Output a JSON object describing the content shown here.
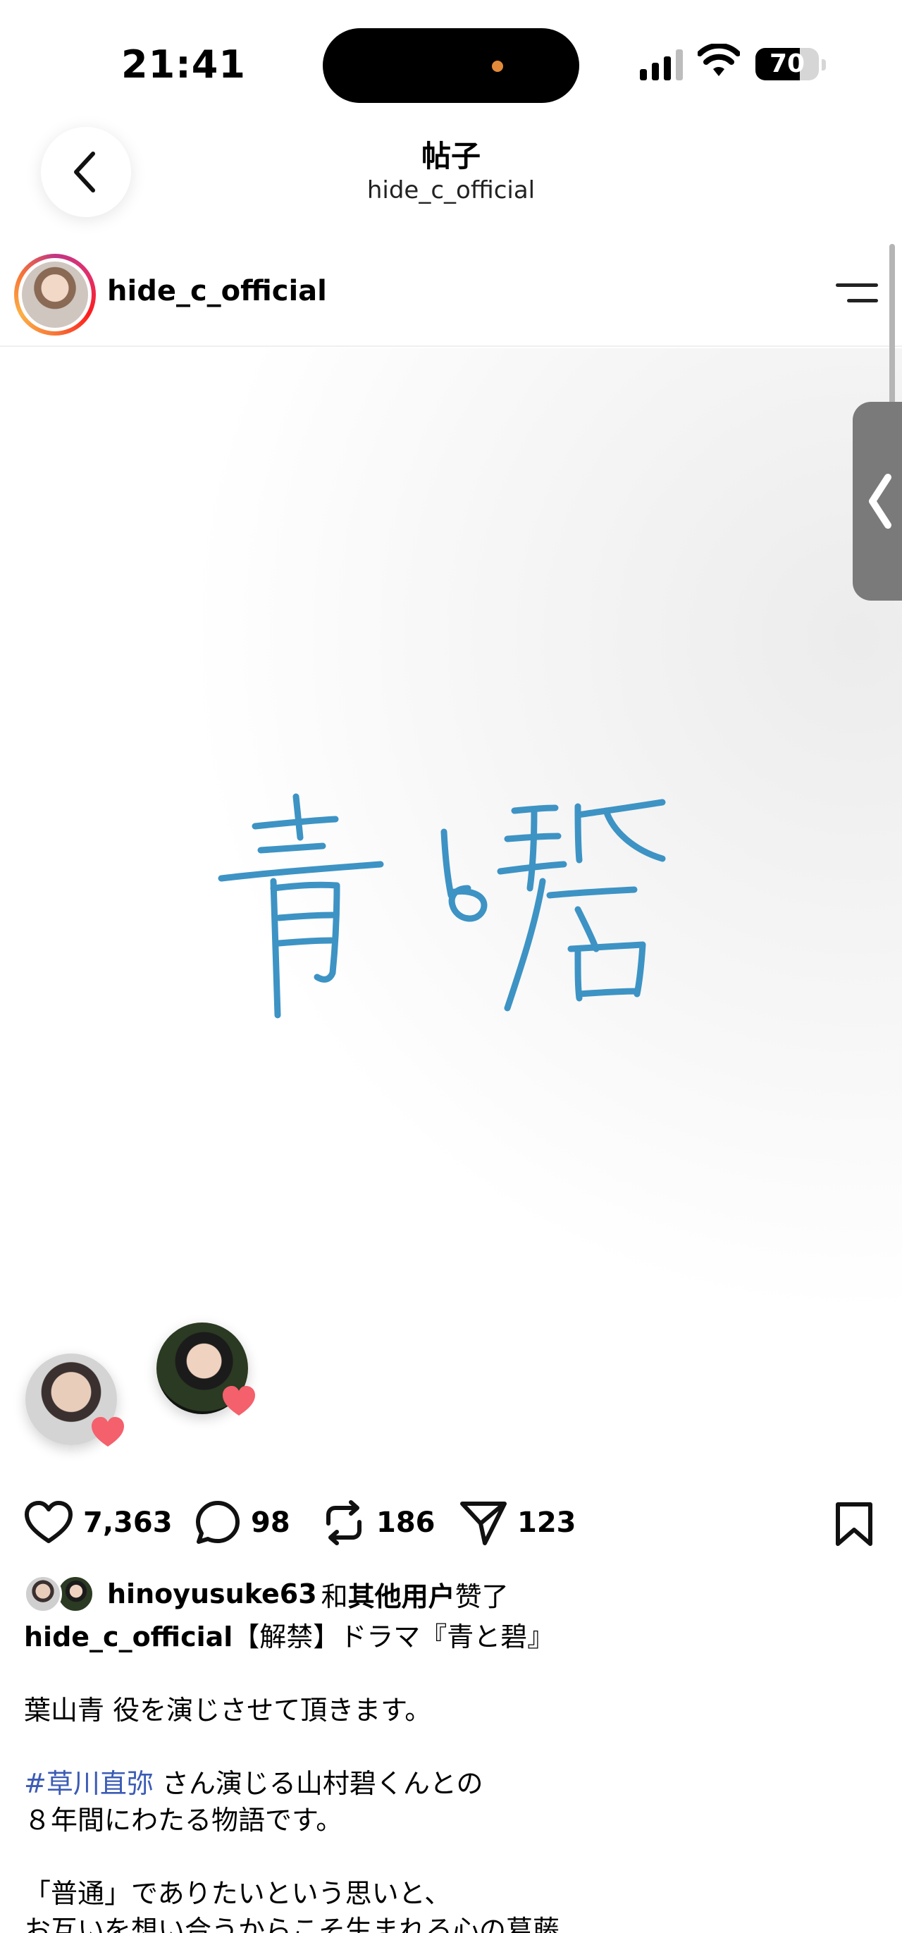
{
  "status_bar": {
    "time": "21:41",
    "battery": "70",
    "battery_level": 0.7
  },
  "nav": {
    "title": "帖子",
    "subtitle": "hide_c_official"
  },
  "post": {
    "username": "hide_c_official"
  },
  "actions": {
    "likes": "7,363",
    "comments": "98",
    "reposts": "186",
    "shares": "123"
  },
  "liked_by": {
    "user": "hinoyusuke63",
    "mid": "和",
    "other": "其他用户",
    "suffix": "赞了"
  },
  "caption": {
    "username": "hide_c_official",
    "line1": "【解禁】ドラマ『青と碧』",
    "line2": "葉山青 役を演じさせて頂きます。",
    "hashtag": "#草川直弥",
    "line3_rest": " さん演じる山村碧くんとの",
    "line4": "８年間にわたる物語です。",
    "line5": "「普通」でありたいという思いと、",
    "line6": "お互いを想い合うからこそ生まれる心の葛藤"
  },
  "colors": {
    "calligraphy": "#3d93c4",
    "hashtag": "#3b5bb5",
    "heart": "#f4606c"
  },
  "icons": [
    "back-chevron-icon",
    "menu-icon",
    "heart-icon",
    "comment-icon",
    "repost-icon",
    "send-icon",
    "bookmark-icon"
  ]
}
